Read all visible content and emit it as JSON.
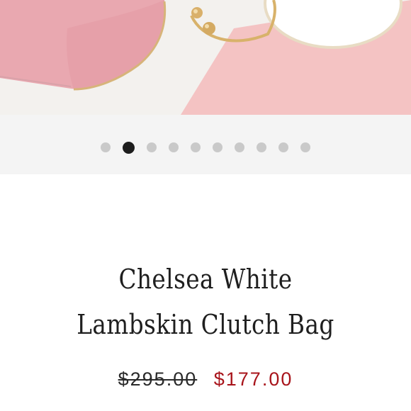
{
  "product": {
    "title_line1": "Chelsea White",
    "title_line2": "Lambskin Clutch Bag",
    "original_price": "$295.00",
    "sale_price": "$177.00"
  },
  "carousel": {
    "total_slides": 10,
    "active_index": 1
  },
  "colors": {
    "accent_sale": "#a8141b",
    "pink": "#f2c1c1",
    "gold": "#d9b36a"
  }
}
